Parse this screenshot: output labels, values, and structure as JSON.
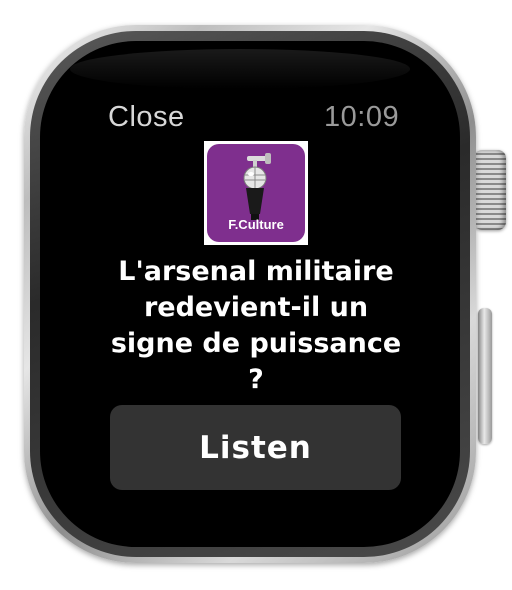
{
  "header": {
    "close_label": "Close",
    "time": "10:09"
  },
  "app": {
    "icon_name": "microphone-icon",
    "icon_text": "F.Culture",
    "brand_color": "#7f2f8e"
  },
  "notification": {
    "title": "L'arsenal militaire redevient-il un signe de puissance ?"
  },
  "actions": {
    "listen_label": "Listen"
  }
}
